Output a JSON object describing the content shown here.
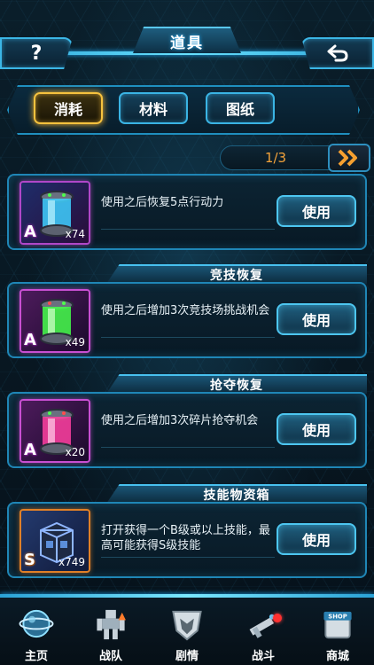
{
  "header": {
    "title": "道具",
    "help_label": "?"
  },
  "tabs": [
    {
      "label": "消耗",
      "active": true
    },
    {
      "label": "材料",
      "active": false
    },
    {
      "label": "图纸",
      "active": false
    }
  ],
  "pagination": {
    "current": 1,
    "total": 3,
    "text": "1/3"
  },
  "items": [
    {
      "section_title": "",
      "rank": "A",
      "quantity": "x74",
      "description": "使用之后恢复5点行动力",
      "button_label": "使用",
      "icon": "blue-energy-canister-icon",
      "glow_color": "#3fd0ff"
    },
    {
      "section_title": "竞技恢复",
      "rank": "A",
      "quantity": "x49",
      "description": "使用之后增加3次竞技场挑战机会",
      "button_label": "使用",
      "icon": "green-energy-canister-icon",
      "glow_color": "#44ff4a"
    },
    {
      "section_title": "抢夺恢复",
      "rank": "A",
      "quantity": "x20",
      "description": "使用之后增加3次碎片抢夺机会",
      "button_label": "使用",
      "icon": "pink-energy-canister-icon",
      "glow_color": "#ff3fa0"
    },
    {
      "section_title": "技能物资箱",
      "rank": "S",
      "quantity": "x749",
      "description": "打开获得一个B级或以上技能，最高可能获得S级技能",
      "button_label": "使用",
      "icon": "skill-supply-box-icon",
      "glow_color": "#6aa8ff"
    }
  ],
  "bottom_nav": [
    {
      "label": "主页",
      "icon": "home-planet-icon",
      "badge": ""
    },
    {
      "label": "战队",
      "icon": "team-robot-icon",
      "badge": "upgrade"
    },
    {
      "label": "剧情",
      "icon": "autobot-story-icon",
      "badge": ""
    },
    {
      "label": "战斗",
      "icon": "battle-gun-icon",
      "badge": "alert"
    },
    {
      "label": "商城",
      "icon": "shop-icon",
      "badge": "",
      "icon_text": "SHOP"
    }
  ],
  "colors": {
    "accent": "#3bb6e6",
    "active_tab": "#f6c23e",
    "page_text": "#f2a23a",
    "rank_a_frame": "#c94fd2",
    "rank_s_frame": "#e08028"
  }
}
